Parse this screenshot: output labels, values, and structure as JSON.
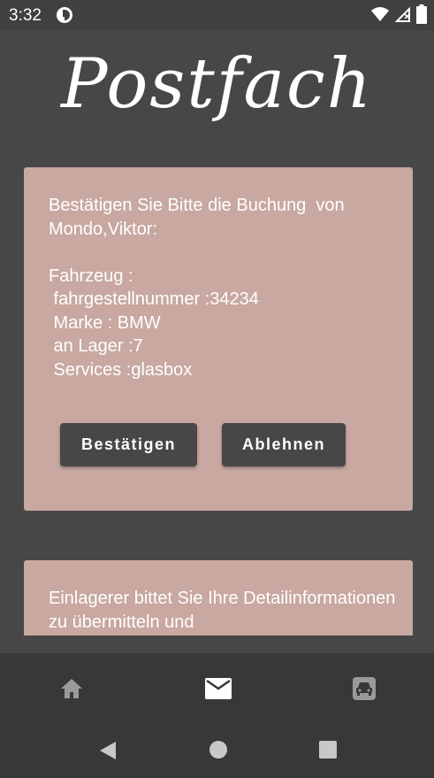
{
  "status": {
    "time": "3:32"
  },
  "app": {
    "title": "Postfach"
  },
  "card1": {
    "text": "Bestätigen Sie Bitte die Buchung  von\nMondo,Viktor:\n\nFahrzeug :\n fahrgestellnummer :34234\n Marke : BMW\n an Lager :7\n Services :glasbox",
    "confirm_label": "Bestätigen",
    "reject_label": "Ablehnen"
  },
  "card2": {
    "text": "Einlagerer bittet Sie Ihre Detailinformationen zu übermitteln und"
  },
  "colors": {
    "background": "#474747",
    "card": "#c8a8a0",
    "nav_bar": "#383838"
  }
}
